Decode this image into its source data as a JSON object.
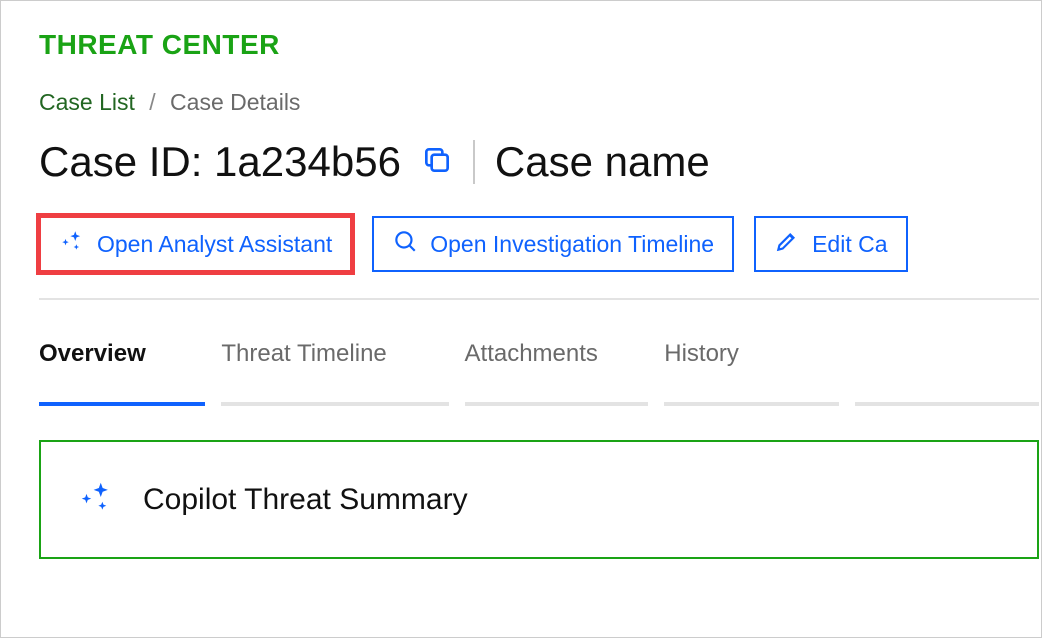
{
  "app_title": "THREAT CENTER",
  "breadcrumb": {
    "parent": "Case List",
    "separator": "/",
    "current": "Case Details"
  },
  "header": {
    "case_id_label": "Case ID: 1a234b56",
    "case_name": "Case name"
  },
  "actions": {
    "analyst_assistant": "Open Analyst Assistant",
    "investigation_timeline": "Open Investigation Timeline",
    "edit_case": "Edit Ca"
  },
  "tabs": {
    "items": [
      {
        "label": "Overview",
        "active": true
      },
      {
        "label": "Threat Timeline",
        "active": false
      },
      {
        "label": "Attachments",
        "active": false
      },
      {
        "label": "History",
        "active": false
      }
    ]
  },
  "summary": {
    "title": "Copilot Threat Summary"
  }
}
